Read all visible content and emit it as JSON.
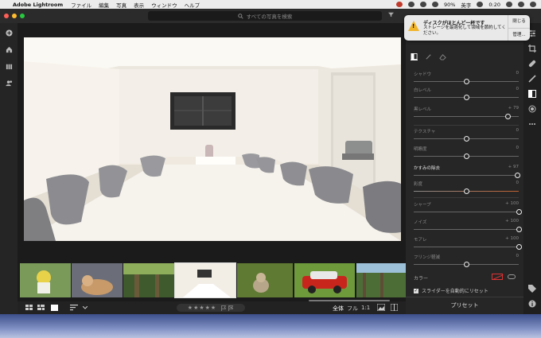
{
  "menubar": {
    "app_name": "Adobe Lightroom",
    "items": [
      "ファイル",
      "編集",
      "写真",
      "表示",
      "ウィンドウ",
      "ヘルプ"
    ],
    "battery": "90%",
    "input_mode": "英字",
    "time": "0:20"
  },
  "search": {
    "placeholder": "すべての写真を検索"
  },
  "notification": {
    "title": "ディスクがほとんど一杯です",
    "message": "ストレージを最適化して領域を節約してください。",
    "close_label": "閉じる",
    "manage_label": "管理..."
  },
  "sliders": [
    {
      "label": "シャドウ",
      "value": "0",
      "position": 0.5,
      "highlight": false
    },
    {
      "label": "白レベル",
      "value": "0",
      "position": 0.5,
      "highlight": false
    },
    {
      "label": "黒レベル",
      "value": "+ 79",
      "position": 0.895,
      "highlight": false
    },
    {
      "label": "テクスチャ",
      "value": "0",
      "position": 0.5,
      "highlight": false
    },
    {
      "label": "明瞭度",
      "value": "0",
      "position": 0.5,
      "highlight": false
    },
    {
      "label": "かすみの除去",
      "value": "+ 97",
      "position": 0.985,
      "highlight": true
    },
    {
      "label": "彩度",
      "value": "0",
      "position": 0.5,
      "highlight": false
    },
    {
      "label": "シャープ",
      "value": "+ 100",
      "position": 1.0,
      "highlight": false
    },
    {
      "label": "ノイズ",
      "value": "+ 100",
      "position": 1.0,
      "highlight": false
    },
    {
      "label": "モアレ",
      "value": "+ 100",
      "position": 1.0,
      "highlight": false
    },
    {
      "label": "フリンジ軽減",
      "value": "0",
      "position": 0.5,
      "highlight": false
    }
  ],
  "color_label": "カラー",
  "auto_reset_label": "スライダーを自動的にリセット",
  "preset_label": "プリセット",
  "bottombar": {
    "stars": "★★★★★",
    "zoom_all": "全体",
    "zoom_full": "フル",
    "zoom_1to1": "1:1"
  },
  "colors": {
    "accent": "#e8e8e8",
    "panel": "#262626",
    "warning": "#f0b429"
  }
}
